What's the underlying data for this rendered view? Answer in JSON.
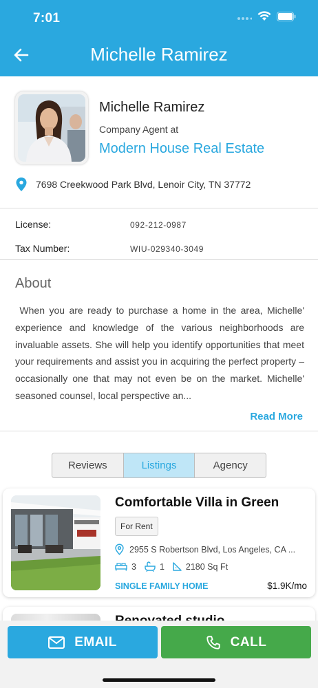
{
  "status_bar": {
    "time": "7:01"
  },
  "header": {
    "title": "Michelle Ramirez"
  },
  "agent": {
    "name": "Michelle Ramirez",
    "role": "Company Agent at",
    "company": "Modern House Real Estate",
    "address": "7698 Creekwood Park Blvd, Lenoir City, TN 37772"
  },
  "details": {
    "license_label": "License:",
    "license_value": "092-212-0987",
    "tax_label": "Tax Number:",
    "tax_value": "WIU-029340-3049"
  },
  "about": {
    "title": "About",
    "text": " When you are ready to purchase a home in the area, Michelle' experience and knowledge of the various neighborhoods are invaluable assets. She will help you identify opportunities that meet your requirements and assist you in acquiring the perfect property – occasionally one that may not even be on the market. Michelle' seasoned counsel, local perspective an...",
    "read_more": "Read More"
  },
  "tabs": [
    {
      "label": "Reviews",
      "active": false
    },
    {
      "label": "Listings",
      "active": true
    },
    {
      "label": "Agency",
      "active": false
    }
  ],
  "listings": [
    {
      "title": "Comfortable Villa in Green",
      "badge": "For Rent",
      "address": "2955 S Robertson Blvd, Los Angeles, CA ...",
      "beds": "3",
      "baths": "1",
      "area": "2180 Sq Ft",
      "type": "SINGLE FAMILY HOME",
      "price": "$1.9K/mo"
    },
    {
      "title": "Renovated studio"
    }
  ],
  "actions": {
    "email_label": "EMAIL",
    "call_label": "CALL"
  },
  "colors": {
    "primary": "#2aa8df",
    "call": "#45a94a",
    "active_tab_bg": "#bfe6f7"
  },
  "icons": {
    "back": "arrow-left-icon",
    "location": "map-pin-icon",
    "bed": "bed-icon",
    "bath": "bath-icon",
    "area": "ruler-icon",
    "email": "mail-icon",
    "call": "phone-icon"
  }
}
